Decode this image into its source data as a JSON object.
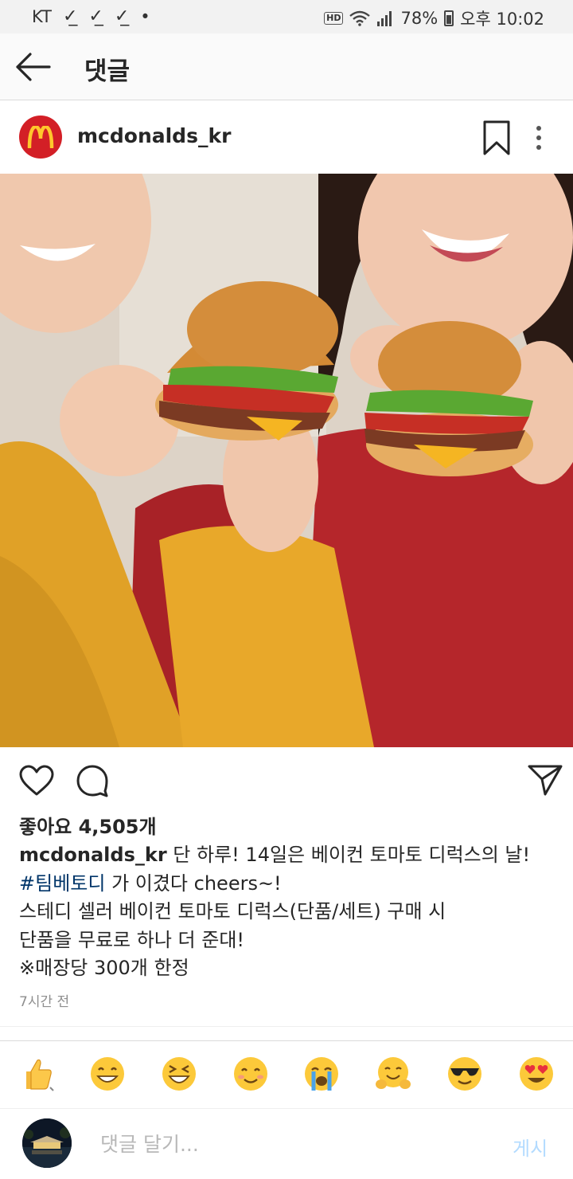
{
  "status_bar": {
    "carrier": "KT",
    "notification_icons": [
      "download-done-icon",
      "download-done-icon",
      "download-done-icon"
    ],
    "dot": "•",
    "hd_badge": "HD",
    "battery": "78%",
    "time": "오후 10:02"
  },
  "header": {
    "title": "댓글"
  },
  "post": {
    "username": "mcdonalds_kr",
    "brand_color": "#d31f26",
    "likes": "좋아요 4,505개",
    "caption": {
      "username": "mcdonalds_kr",
      "line1": " 단 하루! 14일은 베이컨 토마토 디럭스의 날!",
      "hashtag": "#팀베토디",
      "line2_rest": " 가 이겼다 cheers~!",
      "line3": "스테디 셀러 베이컨 토마토 디럭스(단품/세트) 구매 시",
      "line4": "단품을 무료로 하나 더 준대!",
      "line5": "※매장당 300개 한정"
    },
    "timestamp": "7시간 전"
  },
  "emoji_bar": [
    "thumbs-up",
    "grinning",
    "laughing",
    "smiling",
    "crying",
    "hugging",
    "sunglasses",
    "heart-eyes"
  ],
  "comment_bar": {
    "placeholder": "댓글 달기...",
    "post_label": "게시",
    "post_color": "#b3dbff"
  }
}
